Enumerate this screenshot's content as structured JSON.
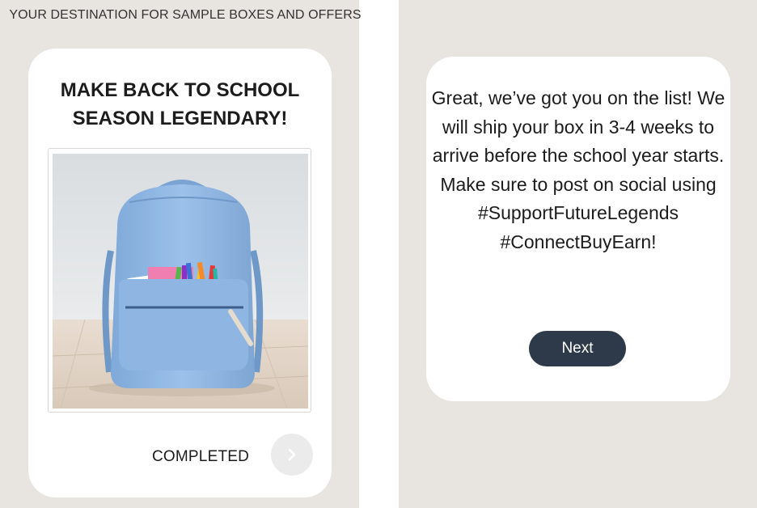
{
  "left_screen": {
    "tagline": "YOUR DESTINATION FOR SAMPLE BOXES AND OFFERS",
    "offer_card": {
      "title": "MAKE BACK TO SCHOOL SEASON LEGENDARY!",
      "image_subject": "backpack-with-school-supplies",
      "status_label": "COMPLETED",
      "arrow_icon": "chevron-right-icon"
    }
  },
  "right_screen": {
    "confirmation_card": {
      "message": "Great, we’ve got you on the list! We will ship your box in 3-4 weeks to arrive before the school year starts. Make sure to post on social using #SupportFutureLegends #ConnectBuyEarn!",
      "next_button_label": "Next"
    }
  },
  "colors": {
    "background": "#e8e4df",
    "card": "#ffffff",
    "next_button": "#2e3a4a",
    "arrow_button": "#ebebeb"
  }
}
